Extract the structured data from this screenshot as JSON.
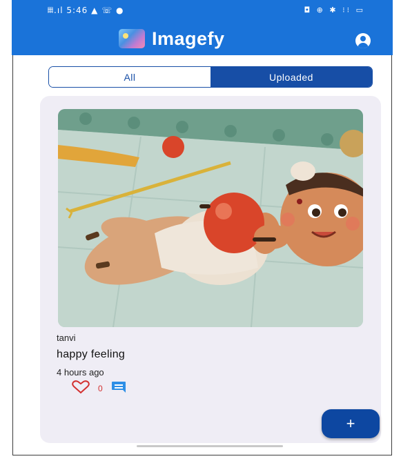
{
  "status_bar": {
    "left": "𝄜.ıl 5:46 ▲ ☏ ●",
    "right": "◘ ⊕ ✱ ⁝⁝ ▭"
  },
  "app_bar": {
    "title": "Imagefy",
    "logo_icon": "image-collage-icon",
    "profile_icon": "account-circle-icon",
    "color": "#1a73d9"
  },
  "tabs": [
    {
      "label": "All",
      "active": false
    },
    {
      "label": "Uploaded",
      "active": true
    }
  ],
  "post": {
    "author": "tanvi",
    "caption": "happy feeling",
    "time": "4 hours ago",
    "likes": "0",
    "like_icon": "heart-outline-icon",
    "comment_icon": "comment-icon"
  },
  "fab": {
    "label": "+"
  },
  "colors": {
    "primary": "#174ea6",
    "card_bg": "#efedf5",
    "like": "#d33030"
  }
}
